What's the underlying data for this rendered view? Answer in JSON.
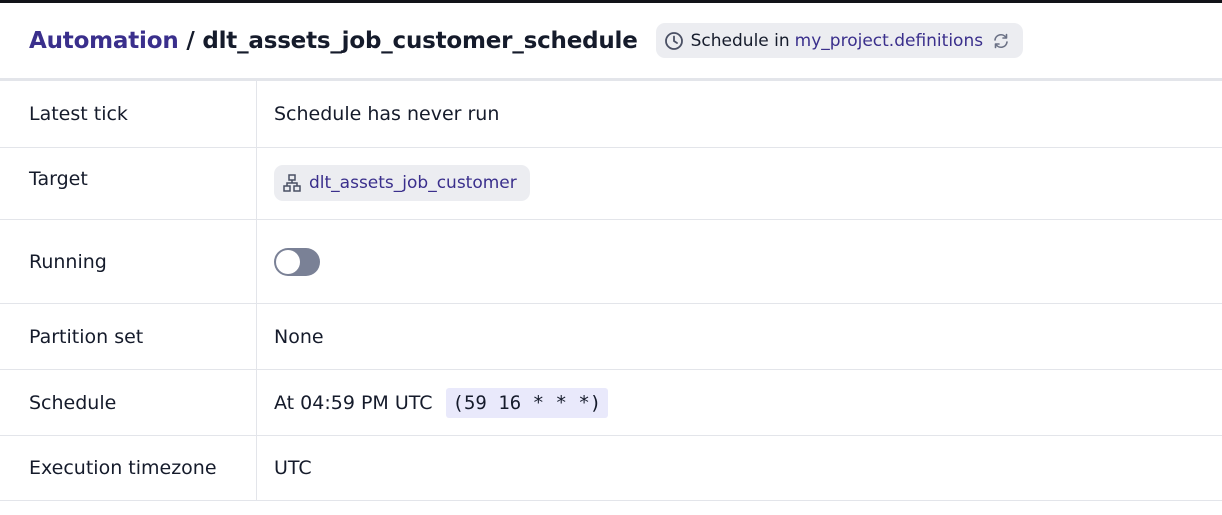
{
  "header": {
    "breadcrumb_root": "Automation",
    "separator": "/",
    "title": "dlt_assets_job_customer_schedule",
    "location_prefix": "Schedule in",
    "location_link": "my_project.definitions",
    "icons": {
      "type": "clock-icon",
      "reload": "reload-icon"
    }
  },
  "rows": {
    "latest_tick": {
      "label": "Latest tick",
      "value": "Schedule has never run"
    },
    "target": {
      "label": "Target",
      "job": "dlt_assets_job_customer",
      "icon": "job-graph-icon"
    },
    "running": {
      "label": "Running",
      "toggle_on": false
    },
    "partition_set": {
      "label": "Partition set",
      "value": "None"
    },
    "schedule": {
      "label": "Schedule",
      "value": "At 04:59 PM UTC",
      "cron": "(59 16 * * *)"
    },
    "timezone": {
      "label": "Execution timezone",
      "value": "UTC"
    }
  },
  "colors": {
    "link": "#3a2f8c",
    "text": "#151b2b",
    "tag_bg": "#ecedf1",
    "border": "#e3e5ea",
    "toggle_off": "#7a8196",
    "cron_bg": "#e9e9fb"
  }
}
